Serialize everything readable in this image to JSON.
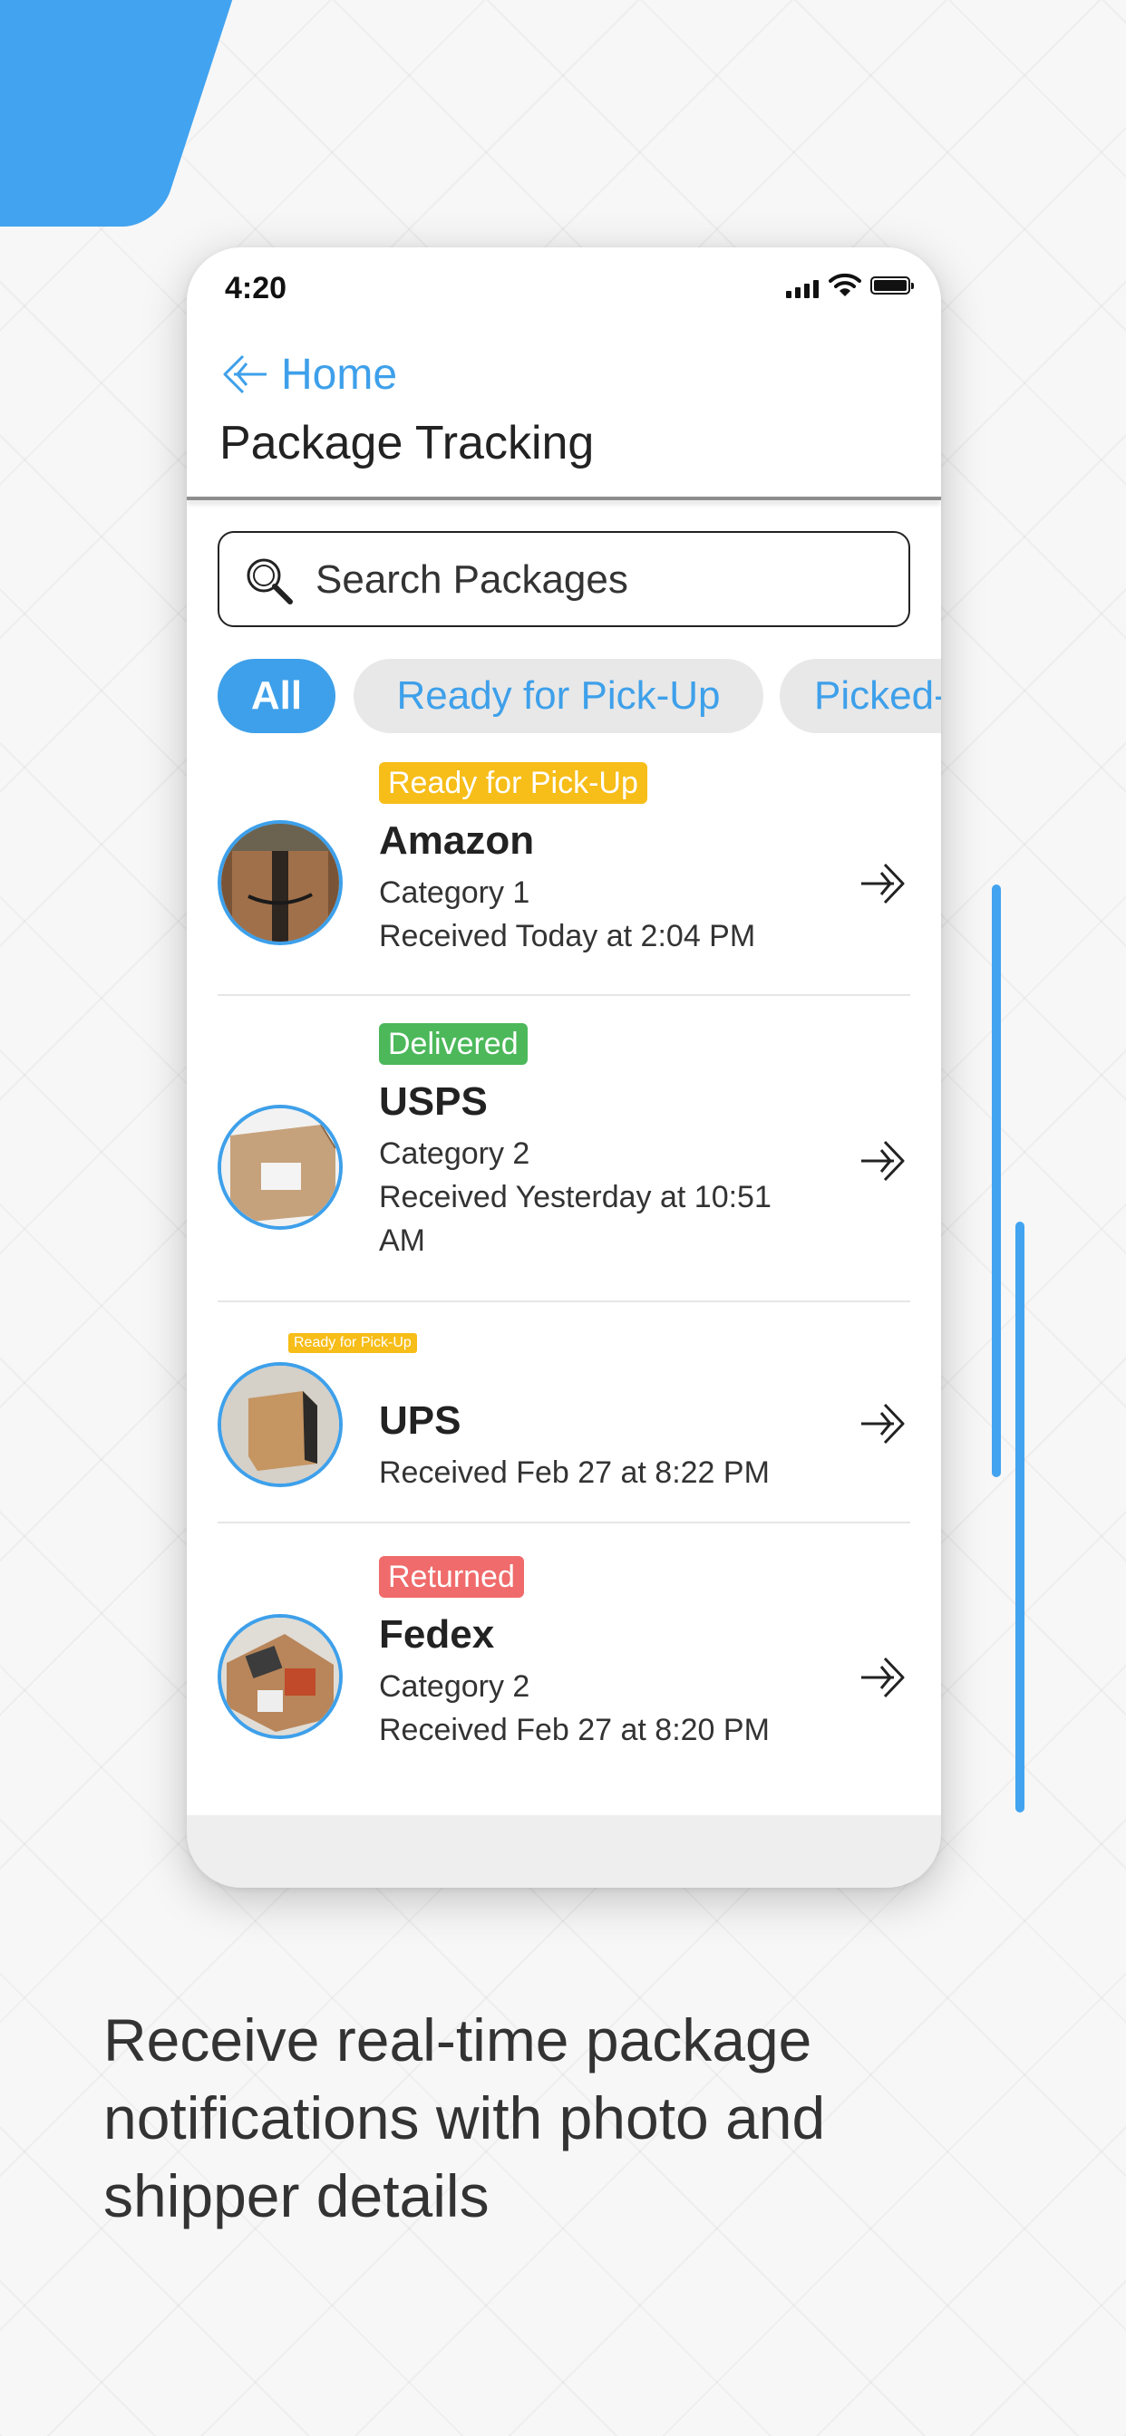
{
  "status_bar": {
    "time": "4:20"
  },
  "header": {
    "back_label": "Home",
    "title": "Package Tracking"
  },
  "search": {
    "placeholder": "Search Packages"
  },
  "filters": [
    "All",
    "Ready for Pick-Up",
    "Picked-"
  ],
  "packages": [
    {
      "status": "Ready for Pick-Up",
      "carrier": "Amazon",
      "category": "Category 1",
      "received_line1": "Received Today at 2:04 PM",
      "received_line2": ""
    },
    {
      "status": "Delivered",
      "carrier": "USPS",
      "category": "Category 2",
      "received_line1": "Received Yesterday at 10:51",
      "received_line2": "AM"
    },
    {
      "status": "Ready for Pick-Up",
      "carrier": "UPS",
      "category": "",
      "received_line1": "Received Feb 27 at 8:22 PM",
      "received_line2": ""
    },
    {
      "status": "Returned",
      "carrier": "Fedex",
      "category": "Category 2",
      "received_line1": "Received Feb 27 at 8:20 PM",
      "received_line2": ""
    }
  ],
  "caption": "Receive real-time package notifications with photo and shipper details",
  "colors": {
    "accent": "#3ea0ea",
    "ready": "#f7bd18",
    "delivered": "#4cb85a",
    "returned": "#f06b6b"
  }
}
